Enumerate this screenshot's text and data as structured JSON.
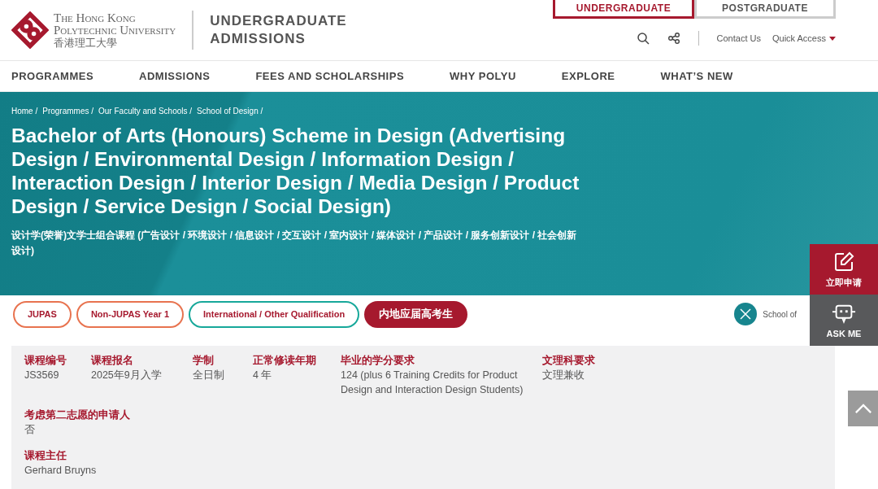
{
  "logo": {
    "line1": "The Hong Kong",
    "line2": "Polytechnic University",
    "line3": "香港理工大學"
  },
  "site_title": {
    "line1": "UNDERGRADUATE",
    "line2": "ADMISSIONS"
  },
  "level_tabs": [
    {
      "label": "UNDERGRADUATE",
      "selected": true
    },
    {
      "label": "POSTGRADUATE",
      "selected": false
    }
  ],
  "utility_links": [
    "Contact Us",
    "Quick Access"
  ],
  "nav": [
    "PROGRAMMES",
    "ADMISSIONS",
    "FEES AND SCHOLARSHIPS",
    "WHY POLYU",
    "EXPLORE",
    "WHAT’S NEW"
  ],
  "breadcrumb": [
    "Home /",
    "Programmes /",
    "Our Faculty and Schools /",
    "School of Design /"
  ],
  "title": "Bachelor of Arts (Honours) Scheme in Design (Advertising Design / Environmental Design / Information Design / Interaction Design / Interior Design / Media Design / Product Design / Service Design / Social Design)",
  "title_zh": "设计学(荣誉)文学士组合课程 (广告设计 / 环境设计 / 信息设计 / 交互设计 / 室内设计 / 媒体设计 / 产品设计 / 服务创新设计 / 社会创新设计)",
  "pathway_tabs": [
    {
      "label": "JUPAS",
      "kind": "coral",
      "selected": false
    },
    {
      "label": "Non-JUPAS Year 1",
      "kind": "coral",
      "selected": false
    },
    {
      "label": "International / Other Qualification",
      "kind": "teal",
      "selected": false
    },
    {
      "label": "内地应届高考生",
      "kind": "maroon",
      "selected": true
    }
  ],
  "school_link": "School of",
  "info_rows": [
    [
      {
        "label": "课程编号",
        "value": "JS3569"
      },
      {
        "label": "课程报名",
        "value": "2025年9月入学"
      },
      {
        "label": "学制",
        "value": "全日制"
      },
      {
        "label": "正常修读年期",
        "value": "4 年"
      },
      {
        "label": "毕业的学分要求",
        "value": "124 (plus 6 Training Credits for Product Design and Interaction Design Students)"
      },
      {
        "label": "文理科要求",
        "value": "文理兼收"
      }
    ],
    [
      {
        "label": "考虑第二志愿的申请人",
        "value": "否"
      }
    ],
    [
      {
        "label": "课程主任",
        "value": "Gerhard Bruyns"
      }
    ]
  ],
  "side_buttons": [
    {
      "label": "立即申请",
      "kind": "apply"
    },
    {
      "label": "ASK ME",
      "kind": "ask"
    }
  ]
}
